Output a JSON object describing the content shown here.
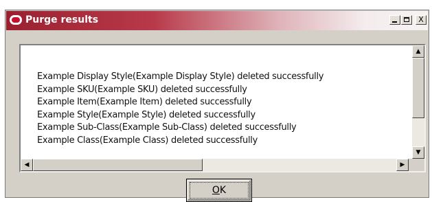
{
  "window": {
    "title": "Purge results",
    "titlebar_colors": [
      "#9a2030",
      "#f7f3f3"
    ],
    "app_icon": "oracle-logo-icon",
    "controls": {
      "minimize_icon": "minimize-icon",
      "maximize_icon": "maximize-icon",
      "close_label": "X"
    }
  },
  "results": {
    "lines": [
      "Example Display Style(Example Display Style) deleted successfully",
      "Example SKU(Example SKU) deleted successfully",
      "Example Item(Example Item) deleted successfully",
      "Example Style(Example Style) deleted successfully",
      "Example Sub-Class(Example Sub-Class) deleted successfully",
      "Example Class(Example Class) deleted successfully"
    ]
  },
  "scrollbars": {
    "up_icon": "arrow-up-icon",
    "down_icon": "arrow-down-icon",
    "left_icon": "arrow-left-icon",
    "right_icon": "arrow-right-icon"
  },
  "ok_button": {
    "label": "OK",
    "mnemonic": "O"
  }
}
